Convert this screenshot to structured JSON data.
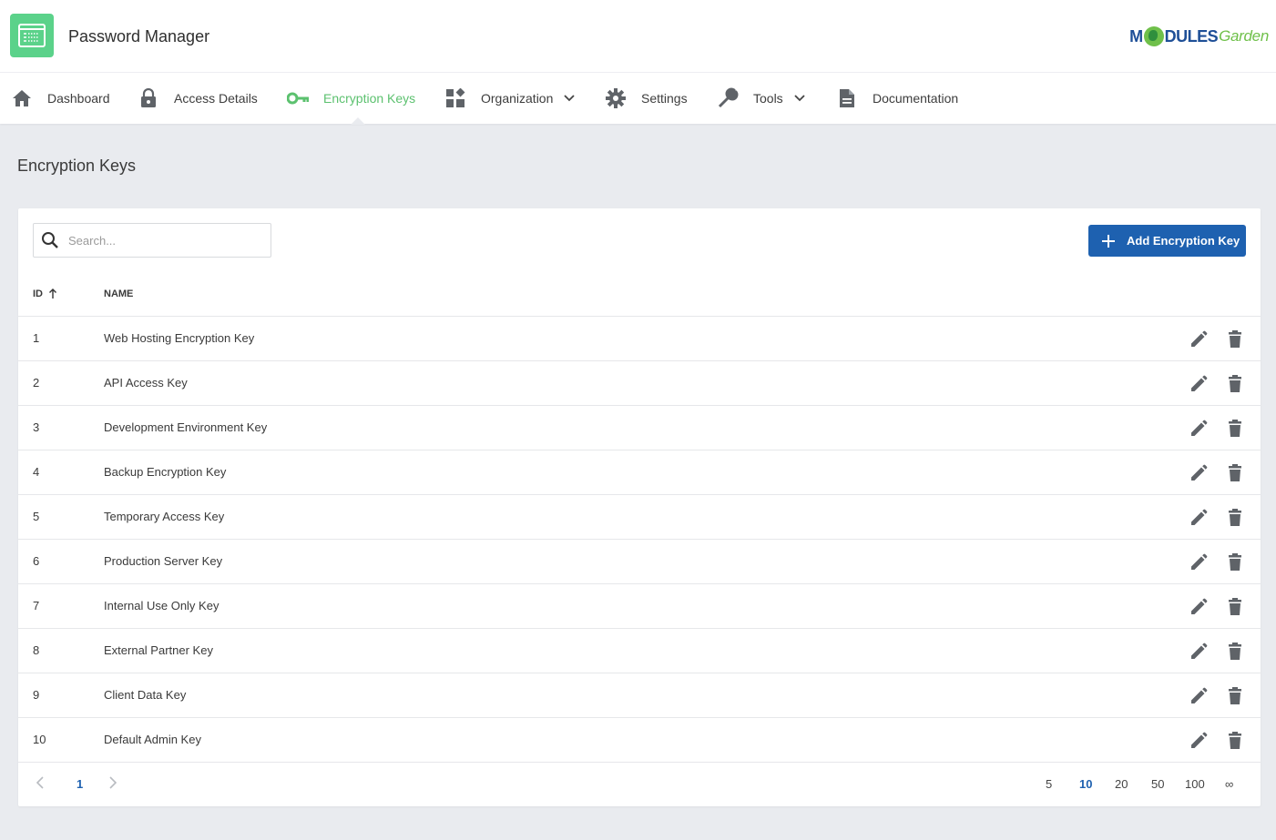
{
  "app": {
    "title": "Password Manager",
    "brand_prefix": "M",
    "brand_mid": "DULES",
    "brand_suffix": "Garden"
  },
  "nav": {
    "items": [
      {
        "label": "Dashboard",
        "icon": "home-icon"
      },
      {
        "label": "Access Details",
        "icon": "lock-icon"
      },
      {
        "label": "Encryption Keys",
        "icon": "key-icon",
        "active": true
      },
      {
        "label": "Organization",
        "icon": "widgets-icon",
        "dropdown": true
      },
      {
        "label": "Settings",
        "icon": "gear-icon"
      },
      {
        "label": "Tools",
        "icon": "wrench-icon",
        "dropdown": true
      },
      {
        "label": "Documentation",
        "icon": "document-icon"
      }
    ],
    "active_color": "#5cc16f"
  },
  "page": {
    "title": "Encryption Keys"
  },
  "search": {
    "placeholder": "Search...",
    "value": ""
  },
  "toolbar": {
    "add_label": "Add Encryption Key",
    "accent": "#1e61b0"
  },
  "table": {
    "columns": {
      "id": "ID",
      "name": "NAME"
    },
    "sort": {
      "column": "id",
      "direction": "asc"
    },
    "rows": [
      {
        "id": "1",
        "name": "Web Hosting Encryption Key"
      },
      {
        "id": "2",
        "name": "API Access Key"
      },
      {
        "id": "3",
        "name": "Development Environment Key"
      },
      {
        "id": "4",
        "name": "Backup Encryption Key"
      },
      {
        "id": "5",
        "name": "Temporary Access Key"
      },
      {
        "id": "6",
        "name": "Production Server Key"
      },
      {
        "id": "7",
        "name": "Internal Use Only Key"
      },
      {
        "id": "8",
        "name": "External Partner Key"
      },
      {
        "id": "9",
        "name": "Client Data Key"
      },
      {
        "id": "10",
        "name": "Default Admin Key"
      }
    ]
  },
  "pagination": {
    "current_page": "1",
    "page_sizes": [
      "5",
      "10",
      "20",
      "50",
      "100",
      "∞"
    ],
    "selected_size": "10"
  }
}
